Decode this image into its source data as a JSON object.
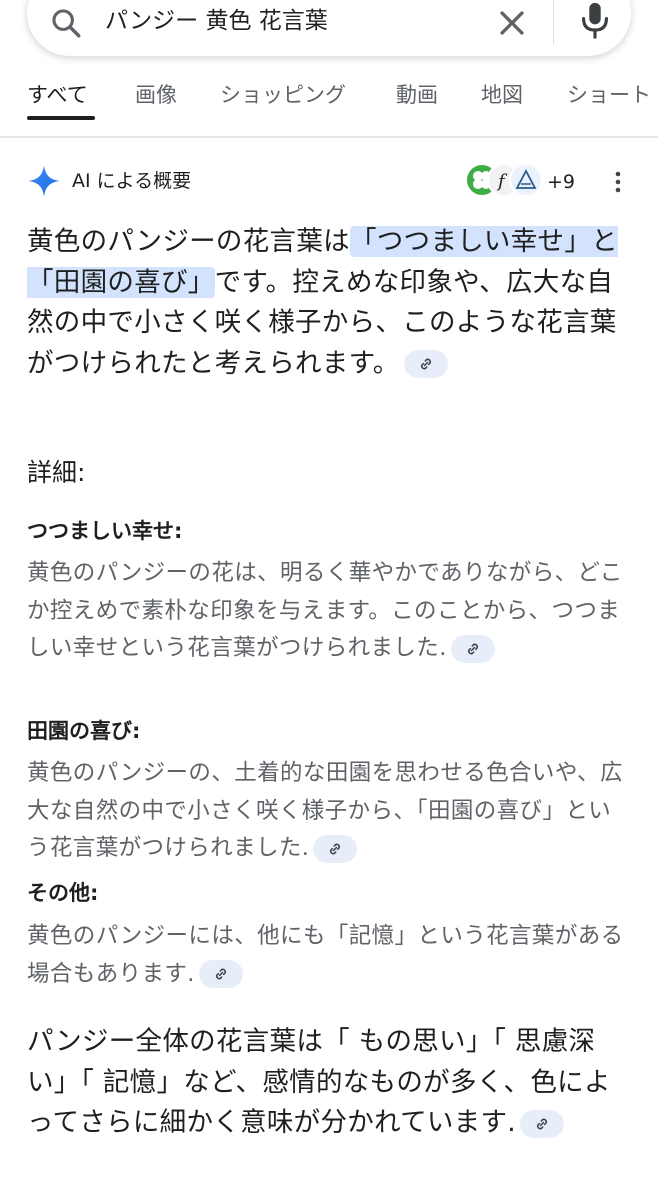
{
  "search": {
    "query": "パンジー 黄色 花言葉"
  },
  "tabs": [
    {
      "label": "すべて"
    },
    {
      "label": "画像"
    },
    {
      "label": "ショッピング"
    },
    {
      "label": "動画"
    },
    {
      "label": "地図"
    },
    {
      "label": "ショート"
    }
  ],
  "ai_overview": {
    "title": "AI による概要",
    "source_count": "+9",
    "lead": {
      "before": "黄色のパンジーの花言葉は",
      "highlight": "「つつましい幸せ」と「田園の喜び」",
      "after": "です。控えめな印象や、広大な自然の中で小さく咲く様子から、このような花言葉がつけられたと考えられます。"
    },
    "details_label": "詳細:",
    "sections": [
      {
        "title": "つつましい幸せ:",
        "body": "黄色のパンジーの花は、明るく華やかでありながら、どこか控えめで素朴な印象を与えます。このことから、つつましい幸せという花言葉がつけられました."
      },
      {
        "title": "田園の喜び:",
        "body": "黄色のパンジーの、土着的な田園を思わせる色合いや、広大な自然の中で小さく咲く様子から、「田園の喜び」という花言葉がつけられました."
      },
      {
        "title": "その他:",
        "body": "黄色のパンジーには、他にも「記憶」という花言葉がある場合もあります."
      }
    ],
    "closing": "パンジー全体の花言葉は「 もの思い」「 思慮深い」「 記憶」など、感情的なものが多く、色によってさらに細かく意味が分かれています."
  },
  "icons": {
    "search": "search-icon",
    "clear": "close-icon",
    "mic": "microphone-icon",
    "sparkle": "gemini-sparkle-icon",
    "link": "link-icon",
    "more": "more-vert-icon"
  },
  "colors": {
    "highlight": "#d3e3fd",
    "chip": "#e8eef9",
    "secondary_text": "#5f6368",
    "sparkle_blue": "#4285f4"
  }
}
